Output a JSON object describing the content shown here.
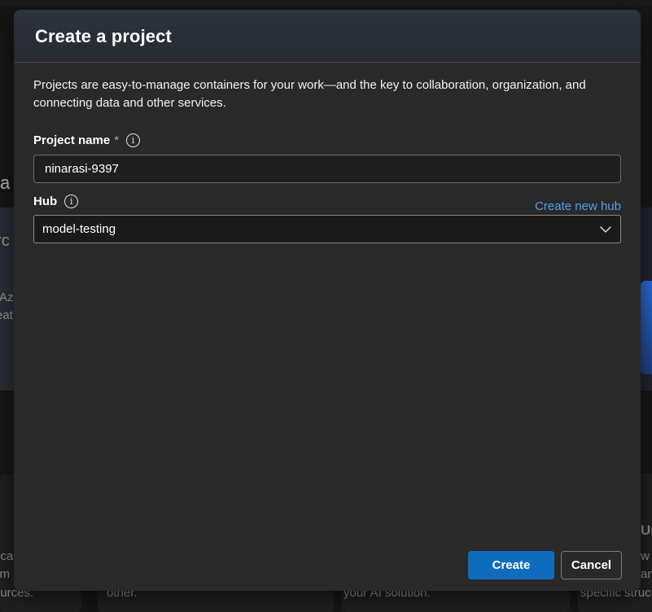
{
  "background": {
    "heading_fragment": "a p",
    "left_card_lines": [
      "urc",
      "?",
      "Az",
      "eat"
    ],
    "bottom_fragments": [
      "oca",
      "ym",
      "ources.",
      "other.",
      "your AI solution.",
      "Ur",
      "w y",
      "an",
      "specific struc"
    ]
  },
  "dialog": {
    "title": "Create a project",
    "description": "Projects are easy-to-manage containers for your work—and the key to collaboration, organization, and connecting data and other services.",
    "project_name": {
      "label": "Project name",
      "required_mark": "*",
      "info_icon": "info-icon",
      "value": "ninarasi-9397"
    },
    "hub": {
      "label": "Hub",
      "info_icon": "info-icon",
      "create_link": "Create new hub",
      "selected": "model-testing",
      "chevron_icon": "chevron-down-icon"
    },
    "footer": {
      "create_label": "Create",
      "cancel_label": "Cancel"
    }
  },
  "colors": {
    "dialog_bg": "#292929",
    "primary": "#0f6cbd",
    "link": "#4da3f0",
    "required": "#f08b8b"
  }
}
